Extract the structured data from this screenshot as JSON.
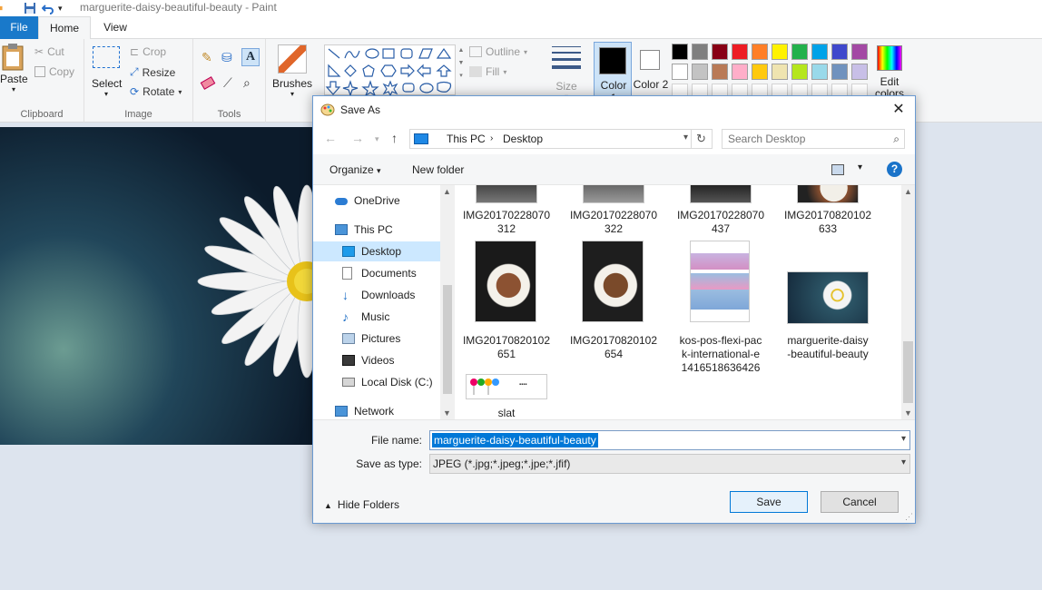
{
  "window": {
    "title": "marguerite-daisy-beautiful-beauty - Paint"
  },
  "ribbon": {
    "tabs": [
      "File",
      "Home",
      "View"
    ],
    "clipboard": {
      "paste": "Paste",
      "cut": "Cut",
      "copy": "Copy",
      "label": "Clipboard"
    },
    "image": {
      "select": "Select",
      "crop": "Crop",
      "resize": "Resize",
      "rotate": "Rotate",
      "label": "Image"
    },
    "tools": {
      "label": "Tools"
    },
    "brushes": "Brushes",
    "shapes": {
      "outline": "Outline",
      "fill": "Fill"
    },
    "size": "Size",
    "color1": "Color 1",
    "color2": "Color 2",
    "edit_colors": "Edit colors",
    "palette_row1": [
      "#000000",
      "#7f7f7f",
      "#880015",
      "#ed1c24",
      "#ff7f27",
      "#fff200",
      "#22b14c",
      "#00a2e8",
      "#3f48cc",
      "#a349a4"
    ],
    "palette_row2": [
      "#ffffff",
      "#c3c3c3",
      "#b97a57",
      "#ffaec9",
      "#ffc90e",
      "#efe4b0",
      "#b5e61d",
      "#99d9ea",
      "#7092be",
      "#c8bfe7"
    ]
  },
  "dialog": {
    "title": "Save As",
    "breadcrumb": [
      "This PC",
      "Desktop"
    ],
    "search_placeholder": "Search Desktop",
    "toolbar": {
      "organize": "Organize",
      "new_folder": "New folder"
    },
    "nav": [
      {
        "label": "OneDrive",
        "icon": "onedrive-icon"
      },
      {
        "label": "This PC",
        "icon": "pc-icon"
      },
      {
        "label": "Desktop",
        "icon": "desktop-icon",
        "selected": true
      },
      {
        "label": "Documents",
        "icon": "documents-icon"
      },
      {
        "label": "Downloads",
        "icon": "downloads-icon"
      },
      {
        "label": "Music",
        "icon": "music-icon"
      },
      {
        "label": "Pictures",
        "icon": "pictures-icon"
      },
      {
        "label": "Videos",
        "icon": "videos-icon"
      },
      {
        "label": "Local Disk (C:)",
        "icon": "disk-icon"
      },
      {
        "label": "Network",
        "icon": "network-icon"
      }
    ],
    "files": [
      {
        "line1": "IMG20170228070",
        "line2": "312"
      },
      {
        "line1": "IMG20170228070",
        "line2": "322"
      },
      {
        "line1": "IMG20170228070",
        "line2": "437"
      },
      {
        "line1": "IMG20170820102",
        "line2": "633"
      },
      {
        "line1": "IMG20170820102",
        "line2": "651"
      },
      {
        "line1": "IMG20170820102",
        "line2": "654"
      },
      {
        "line1": "kos-pos-flexi-pac",
        "line2": "k-international-e",
        "line3": "1416518636426"
      },
      {
        "line1": "marguerite-daisy",
        "line2": "-beautiful-beauty"
      },
      {
        "line1": "slat"
      }
    ],
    "file_name_label": "File name:",
    "file_name": "marguerite-daisy-beautiful-beauty",
    "save_as_type_label": "Save as type:",
    "save_as_type": "JPEG (*.jpg;*.jpeg;*.jpe;*.jfif)",
    "hide_folders": "Hide Folders",
    "save": "Save",
    "cancel": "Cancel"
  }
}
